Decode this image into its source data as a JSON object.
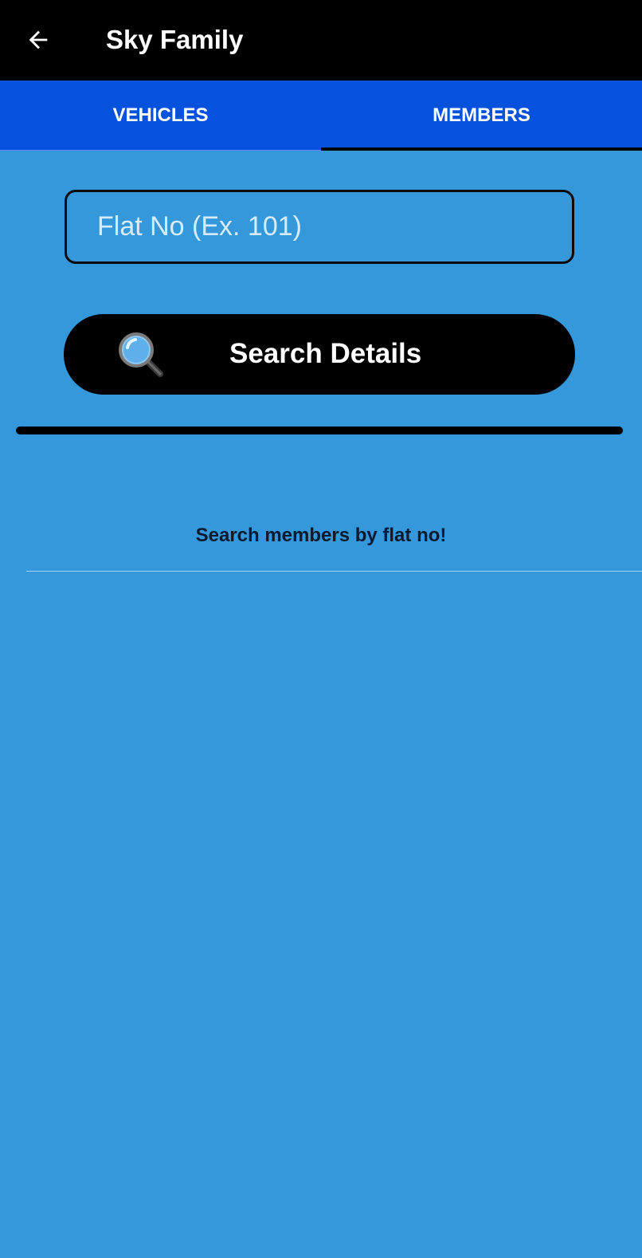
{
  "appbar": {
    "title": "Sky Family",
    "back_icon": "arrow-left-icon"
  },
  "tabs": [
    {
      "label": "VEHICLES",
      "selected": false
    },
    {
      "label": "MEMBERS",
      "selected": true
    }
  ],
  "search": {
    "placeholder": "Flat No (Ex. 101)",
    "value": "",
    "button_label": "Search Details",
    "button_icon": "magnifier-icon"
  },
  "empty_state": {
    "message": "Search members by flat no!"
  },
  "colors": {
    "background": "#3498db",
    "appbar": "#000000",
    "tabbar": "#0652dd",
    "button": "#000000",
    "text_light": "#ffffff",
    "text_dark": "#0b1a2e"
  }
}
